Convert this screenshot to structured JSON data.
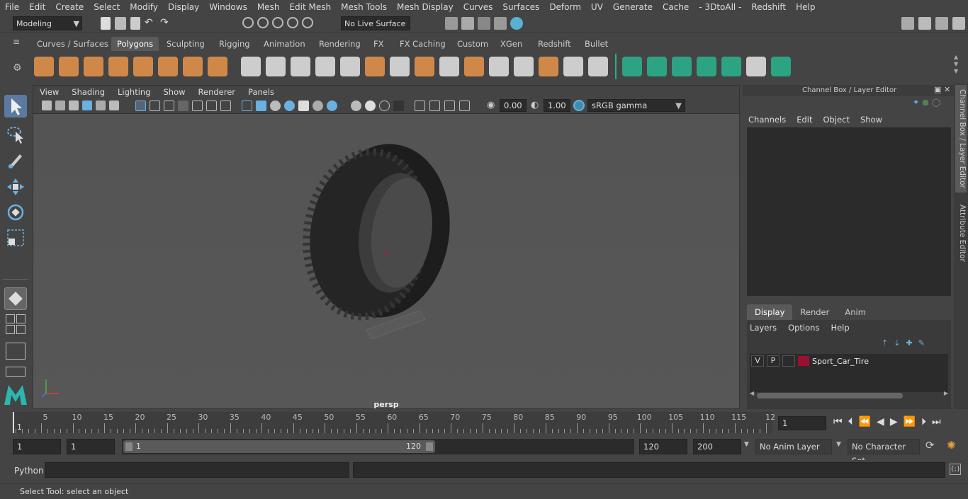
{
  "menubar": [
    "File",
    "Edit",
    "Create",
    "Select",
    "Modify",
    "Display",
    "Windows",
    "Mesh",
    "Edit Mesh",
    "Mesh Tools",
    "Mesh Display",
    "Curves",
    "Surfaces",
    "Deform",
    "UV",
    "Generate",
    "Cache",
    "- 3DtoAll -",
    "Redshift",
    "Help"
  ],
  "status": {
    "mode": "Modeling",
    "live_surface": "No Live Surface"
  },
  "shelf_tabs": [
    "Curves / Surfaces",
    "Polygons",
    "Sculpting",
    "Rigging",
    "Animation",
    "Rendering",
    "FX",
    "FX Caching",
    "Custom",
    "XGen",
    "Redshift",
    "Bullet"
  ],
  "shelf_active": "Polygons",
  "viewport": {
    "menus": [
      "View",
      "Shading",
      "Lighting",
      "Show",
      "Renderer",
      "Panels"
    ],
    "exposure": "0.00",
    "gamma": "1.00",
    "colorspace": "sRGB gamma",
    "camera": "persp"
  },
  "channelbox": {
    "title": "Channel Box / Layer Editor",
    "menus": [
      "Channels",
      "Edit",
      "Object",
      "Show"
    ],
    "layer_tabs": [
      "Display",
      "Render",
      "Anim"
    ],
    "layer_active": "Display",
    "layer_menus": [
      "Layers",
      "Options",
      "Help"
    ],
    "layer": {
      "v": "V",
      "p": "P",
      "name": "Sport_Car_Tire",
      "color": "#9b1030"
    }
  },
  "side_tabs": [
    "Channel Box / Layer Editor",
    "Attribute Editor"
  ],
  "timeline": {
    "labels": [
      "5",
      "10",
      "15",
      "20",
      "25",
      "30",
      "35",
      "40",
      "45",
      "50",
      "55",
      "60",
      "65",
      "70",
      "75",
      "80",
      "85",
      "90",
      "95",
      "100",
      "105",
      "110",
      "115",
      "12"
    ],
    "start_marker": "1",
    "current_frame": "1"
  },
  "range": {
    "start": "1",
    "playback_start": "1",
    "slider_start": "1",
    "slider_end": "120",
    "end": "120",
    "anim_end": "200",
    "anim_layer": "No Anim Layer",
    "char_set": "No Character Set"
  },
  "cmdline": {
    "lang": "Python"
  },
  "help": "Select Tool: select an object"
}
